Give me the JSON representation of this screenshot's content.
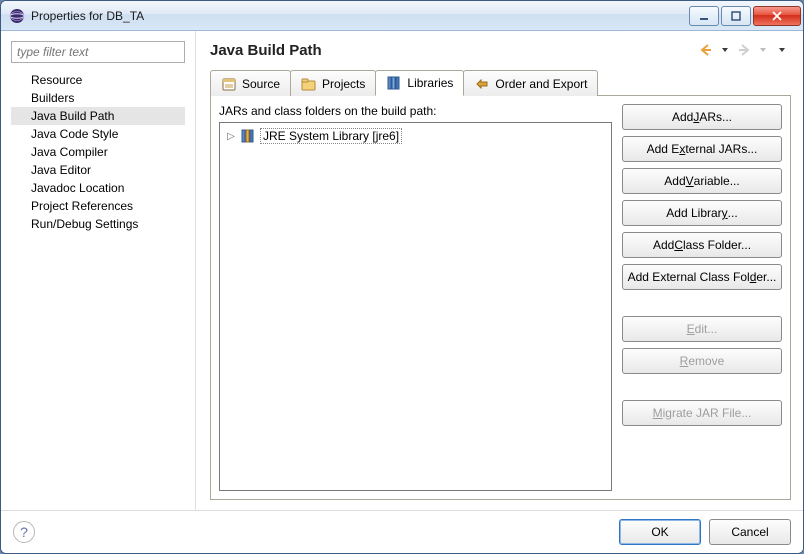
{
  "window": {
    "title": "Properties for DB_TA"
  },
  "sidebar": {
    "filter_placeholder": "type filter text",
    "items": [
      "Resource",
      "Builders",
      "Java Build Path",
      "Java Code Style",
      "Java Compiler",
      "Java Editor",
      "Javadoc Location",
      "Project References",
      "Run/Debug Settings"
    ],
    "selected_index": 2
  },
  "main": {
    "title": "Java Build Path",
    "tabs": [
      {
        "label": "Source",
        "icon": "source"
      },
      {
        "label": "Projects",
        "icon": "projects"
      },
      {
        "label": "Libraries",
        "icon": "libraries"
      },
      {
        "label": "Order and Export",
        "icon": "order"
      }
    ],
    "active_tab_index": 2,
    "lib_label": "JARs and class folders on the build path:",
    "lib_items": [
      {
        "label": "JRE System Library [jre6]",
        "icon": "library"
      }
    ],
    "buttons": [
      {
        "key": "add_jars",
        "html": "Add <u>J</u>ARs...",
        "enabled": true
      },
      {
        "key": "add_ext_jars",
        "html": "Add E<u>x</u>ternal JARs...",
        "enabled": true
      },
      {
        "key": "add_variable",
        "html": "Add <u>V</u>ariable...",
        "enabled": true
      },
      {
        "key": "add_library",
        "html": "Add Librar<u>y</u>...",
        "enabled": true
      },
      {
        "key": "add_class_folder",
        "html": "Add <u>C</u>lass Folder...",
        "enabled": true
      },
      {
        "key": "add_ext_class",
        "html": "Add External Class Fol<u>d</u>er...",
        "enabled": true
      },
      {
        "key": "gap1",
        "gap": true
      },
      {
        "key": "edit",
        "html": "<u>E</u>dit...",
        "enabled": false
      },
      {
        "key": "remove",
        "html": "<u>R</u>emove",
        "enabled": false
      },
      {
        "key": "gap2",
        "gap": true
      },
      {
        "key": "migrate",
        "html": "<u>M</u>igrate JAR File...",
        "enabled": false
      }
    ]
  },
  "footer": {
    "ok": "OK",
    "cancel": "Cancel"
  }
}
